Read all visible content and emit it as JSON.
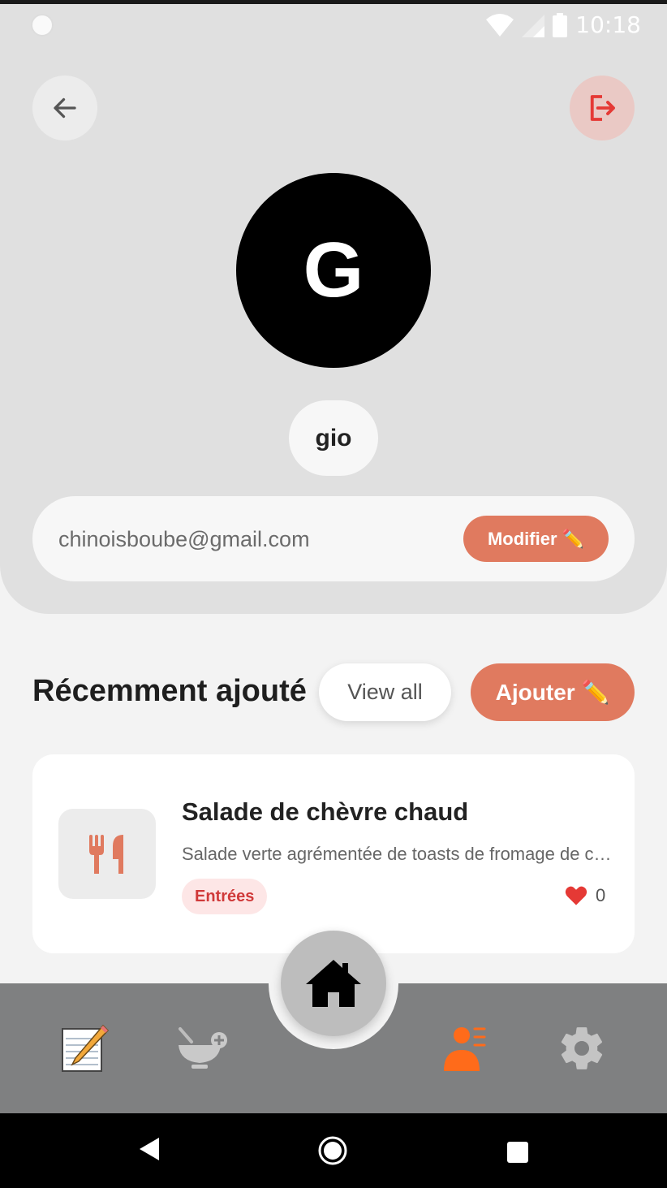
{
  "status_bar": {
    "time": "10:18",
    "icons": [
      "wifi-icon",
      "signal-icon",
      "battery-icon"
    ]
  },
  "header": {
    "back_icon": "arrow-left-icon",
    "logout_icon": "logout-icon"
  },
  "profile": {
    "avatar_initial": "G",
    "username": "gio",
    "email": "chinoisboube@gmail.com",
    "modify_label": "Modifier ✏️"
  },
  "recent": {
    "title": "Récemment ajouté",
    "view_all_label": "View all",
    "add_label": "Ajouter ✏️"
  },
  "recipes": [
    {
      "title": "Salade de chèvre chaud",
      "description": "Salade verte agrémentée de toasts de fromage de chèvre chaud",
      "tag": "Entrées",
      "likes": "0",
      "icon": "utensils-icon"
    }
  ],
  "bottom_nav": {
    "items": [
      {
        "icon": "notepad-icon",
        "active": false
      },
      {
        "icon": "bowl-add-icon",
        "active": false
      },
      {
        "icon": "home-icon",
        "active": false
      },
      {
        "icon": "user-list-icon",
        "active": true
      },
      {
        "icon": "gear-icon",
        "active": false
      }
    ]
  },
  "colors": {
    "accent": "#e07a5f",
    "active_nav": "#ff6b1a",
    "logout_red": "#e53935",
    "heart": "#e53935"
  }
}
